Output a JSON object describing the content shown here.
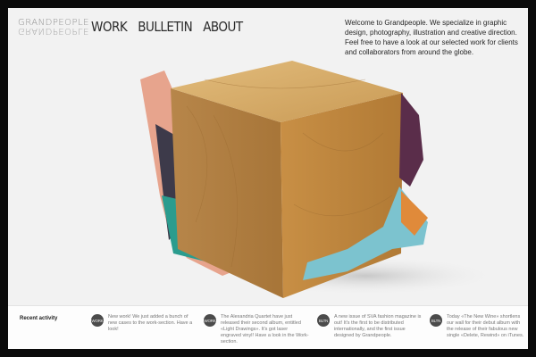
{
  "logo": {
    "line1": "GRANDPEOPLE",
    "line2": "GRANDPEOPLE"
  },
  "nav": [
    {
      "label": "WORK"
    },
    {
      "label": "BULLETIN"
    },
    {
      "label": "ABOUT"
    }
  ],
  "intro": "Welcome to Grandpeople. We specialize in graphic design, photography, illustration and creative direction. Feel free to have a look at our selected work for clients and collaborators from around the globe.",
  "footer": {
    "recent_label": "Recent activity",
    "items": [
      {
        "badge": "WORK",
        "text": "New work! We just added a bunch of new cases to the work-section. Have a look!"
      },
      {
        "badge": "WORK",
        "text": "The Alexandria Quartet have just released their second album, entitled «Light Drawings». It's got laser engraved vinyl! Have a look in the Work-section."
      },
      {
        "badge": "BLTN",
        "text": "A new issue of SVA fashion magazine is out! It's the first to be distributed internationally, and the first issue designed by Grandpeople."
      },
      {
        "badge": "BLTN",
        "text": "Today «The New Wine» shortlens our wall for their debut album with the release of their fabulous new single «Delete, Rewind» on iTunes."
      }
    ]
  }
}
